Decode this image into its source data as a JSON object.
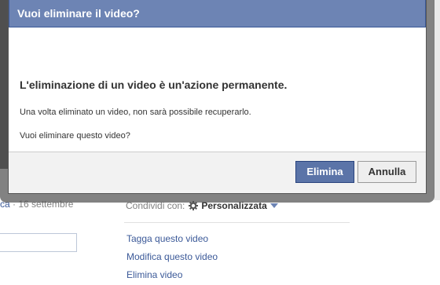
{
  "dialog": {
    "title": "Vuoi eliminare il video?",
    "heading": "L'eliminazione di un video è un'azione permanente.",
    "line1": "Una volta eliminato un video, non sarà possibile recuperarlo.",
    "line2": "Vuoi eliminare questo video?",
    "confirm_label": "Elimina",
    "cancel_label": "Annulla"
  },
  "page": {
    "meta_link": "ca",
    "meta_date": " · 16 settembre",
    "share_label": "Condividi con:",
    "share_value": "Personalizzata",
    "links": [
      "Tagga questo video",
      "Modifica questo video",
      "Elimina video"
    ]
  },
  "colors": {
    "header_bg": "#6d84b4",
    "primary_button": "#5b74a8",
    "link": "#3b5998"
  },
  "icons": {
    "privacy": "gear-icon",
    "dropdown": "triangle-down-icon"
  }
}
